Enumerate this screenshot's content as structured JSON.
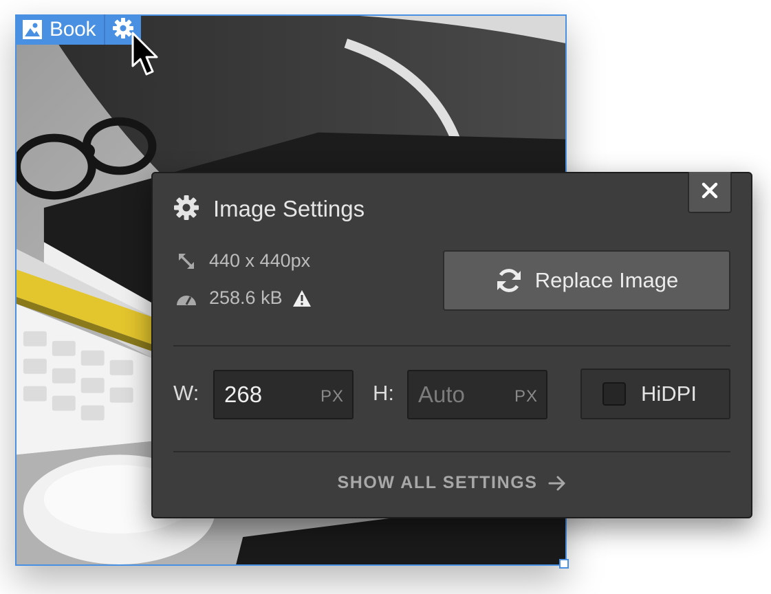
{
  "element_tag": {
    "name": "Book"
  },
  "panel": {
    "title": "Image Settings",
    "dimensions": "440 x 440px",
    "file_size": "258.6 kB",
    "replace_label": "Replace Image",
    "width_label": "W:",
    "width_value": "268",
    "width_unit": "PX",
    "height_label": "H:",
    "height_placeholder": "Auto",
    "height_unit": "PX",
    "hidpi_label": "HiDPI",
    "hidpi_checked": false,
    "show_all_label": "SHOW ALL SETTINGS"
  },
  "icons": {
    "image": "image-icon",
    "gear": "gear-icon",
    "close": "close-icon",
    "resize": "resize-arrow-icon",
    "gauge": "gauge-icon",
    "warning": "warning-icon",
    "refresh": "refresh-icon",
    "arrow": "arrow-right-icon"
  },
  "colors": {
    "selection": "#4a90e2",
    "panel_background": "#3d3d3d",
    "button_background": "#5c5c5c"
  }
}
